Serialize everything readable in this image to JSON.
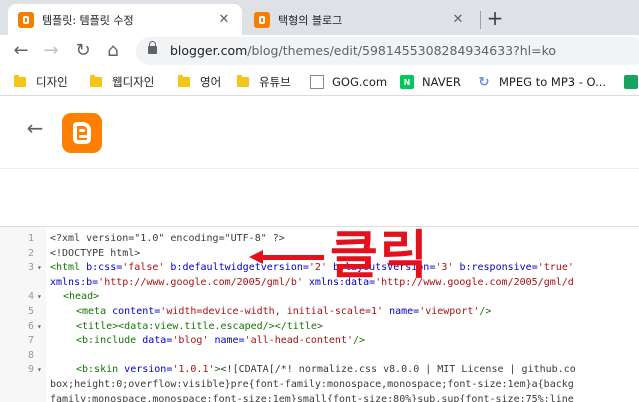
{
  "tabs": [
    {
      "title": "템플릿: 템플릿 수정",
      "close": "✕"
    },
    {
      "title": "택형의 블로그",
      "close": "✕"
    }
  ],
  "new_tab": "+",
  "nav": {
    "back": "←",
    "forward": "→",
    "reload": "↻",
    "home": "⌂"
  },
  "address": {
    "host": "blogger.com",
    "path": "/blog/themes/edit/5981455308284934633?hl=ko"
  },
  "bookmarks": [
    {
      "label": "디자인",
      "icon": "folder-icon"
    },
    {
      "label": "웹디자인",
      "icon": "folder-icon"
    },
    {
      "label": "영어",
      "icon": "folder-icon"
    },
    {
      "label": "유튜브",
      "icon": "folder-icon"
    },
    {
      "label": "GOG.com",
      "icon": "gog-icon"
    },
    {
      "label": "NAVER",
      "icon": "naver-icon"
    },
    {
      "label": "MPEG to MP3 - O...",
      "icon": "converter-icon"
    }
  ],
  "app": {
    "back": "←"
  },
  "editor": {
    "lines": [
      {
        "n": "1",
        "fold": "",
        "indent": 0,
        "parts": [
          [
            "code",
            "<?xml version=\"1.0\" encoding=\"UTF-8\" ?>"
          ]
        ]
      },
      {
        "n": "2",
        "fold": "",
        "indent": 0,
        "parts": [
          [
            "code",
            "<!DOCTYPE html>"
          ]
        ]
      },
      {
        "n": "3",
        "fold": "▾",
        "indent": 0,
        "parts": [
          [
            "tag",
            "<html "
          ],
          [
            "attr",
            "b:css="
          ],
          [
            "str",
            "'false' "
          ],
          [
            "attr",
            "b:defaultwidgetversion="
          ],
          [
            "str",
            "'2' "
          ],
          [
            "attr",
            "b:layoutsVersion="
          ],
          [
            "str",
            "'3' "
          ],
          [
            "attr",
            "b:responsive="
          ],
          [
            "str",
            "'true'"
          ]
        ]
      },
      {
        "n": "",
        "fold": "",
        "indent": 0,
        "parts": [
          [
            "attr",
            "xmlns:b="
          ],
          [
            "str",
            "'http://www.google.com/2005/gml/b' "
          ],
          [
            "attr",
            "xmlns:data="
          ],
          [
            "str",
            "'http://www.google.com/2005/gml/d"
          ]
        ]
      },
      {
        "n": "4",
        "fold": "▾",
        "indent": 1,
        "parts": [
          [
            "tag",
            "<head>"
          ]
        ]
      },
      {
        "n": "5",
        "fold": "",
        "indent": 2,
        "parts": [
          [
            "tag",
            "<meta "
          ],
          [
            "attr",
            "content="
          ],
          [
            "str",
            "'width=device-width, initial-scale=1' "
          ],
          [
            "attr",
            "name="
          ],
          [
            "str",
            "'viewport'"
          ],
          [
            "tag",
            "/>"
          ]
        ]
      },
      {
        "n": "6",
        "fold": "▾",
        "indent": 2,
        "parts": [
          [
            "tag",
            "<title>"
          ],
          [
            "tag",
            "<data:view.title.escaped/>"
          ],
          [
            "tag",
            "</title>"
          ]
        ]
      },
      {
        "n": "7",
        "fold": "",
        "indent": 2,
        "parts": [
          [
            "tag",
            "<b:include "
          ],
          [
            "attr",
            "data="
          ],
          [
            "str",
            "'blog' "
          ],
          [
            "attr",
            "name="
          ],
          [
            "str",
            "'all-head-content'"
          ],
          [
            "tag",
            "/>"
          ]
        ]
      },
      {
        "n": "8",
        "fold": "",
        "indent": 0,
        "parts": []
      },
      {
        "n": "9",
        "fold": "▾",
        "indent": 2,
        "parts": [
          [
            "tag",
            "<b:skin "
          ],
          [
            "attr",
            "version="
          ],
          [
            "str",
            "'1.0.1'"
          ],
          [
            "tag",
            ">"
          ],
          [
            "code",
            "<![CDATA[/*! normalize.css v8.0.0 | MIT License | github.co"
          ]
        ]
      },
      {
        "n": "",
        "fold": "",
        "indent": 0,
        "parts": [
          [
            "code",
            "box;height:0;overflow:visible}pre{font-family:monospace,monospace;font-size:1em}a{backg"
          ]
        ]
      },
      {
        "n": "",
        "fold": "",
        "indent": 0,
        "parts": [
          [
            "code",
            "family:monospace,monospace;font-size:1em}small{font-size:80%}sub,sup{font-size:75%;line"
          ]
        ]
      }
    ]
  },
  "annotation": {
    "text": "클릭",
    "color": "#e4101b"
  },
  "colors": {
    "accent": "#f57d00",
    "tabstrip": "#dee1e6"
  }
}
